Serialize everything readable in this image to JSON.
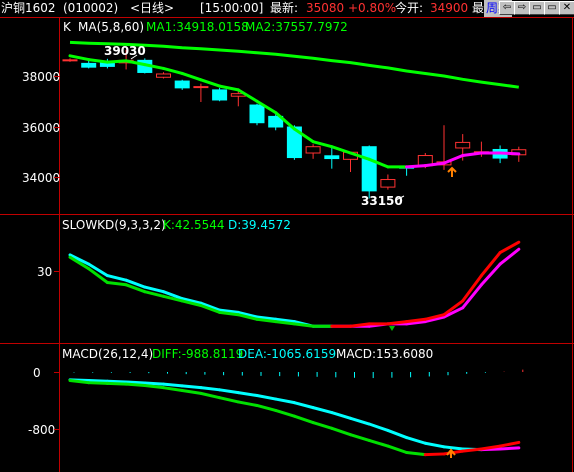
{
  "header": {
    "symbol": "沪铜1602",
    "code": "(010002)",
    "period_tag": "<日线>",
    "time": "[15:00:00]",
    "latest_label": "最新:",
    "latest_value": "35080",
    "change": "+0.80%",
    "open_label": "今开:",
    "open_value": "34900",
    "high_label": "最高:",
    "period_link": "周期",
    "nav_buttons": [
      "⇦",
      "⇨",
      "▭",
      "▭",
      "✕"
    ]
  },
  "colors": {
    "up": "#ff3232",
    "down": "#00ffff",
    "ma1": "#00ff00",
    "ma2": "#00ff00",
    "kd_k": "#00e000",
    "kd_d": "#00ffff",
    "macd_diff": "#00e000",
    "macd_dea": "#00ffff",
    "accent_red": "#ff0000",
    "accent_magenta": "#ff00ff"
  },
  "price_panel": {
    "label_k": "K",
    "ma_label": "MA(5,8,60)",
    "ma1_label": "MA1:34918.0158",
    "ma2_label": "MA2:37557.7972",
    "y_ticks": [
      "38000",
      "36000",
      "34000"
    ],
    "annotation_high": "39030",
    "annotation_low": "33150"
  },
  "kd_panel": {
    "label": "SLOWKD(9,3,3,2)",
    "k_label": "K:42.5544",
    "d_label": "D:39.4572",
    "y_ticks": [
      "30"
    ]
  },
  "macd_panel": {
    "label": "MACD(26,12,4)",
    "diff_label": "DIFF:-988.8119",
    "dea_label": "DEA:-1065.6159",
    "macd_label": "MACD:153.6080",
    "y_ticks": [
      "0",
      "-800"
    ]
  },
  "chart_data": {
    "type": "line",
    "candles": [
      {
        "o": 38640,
        "c": 38640,
        "h": 38700,
        "l": 38560
      },
      {
        "o": 38500,
        "c": 38350,
        "h": 38600,
        "l": 38300
      },
      {
        "o": 38520,
        "c": 38380,
        "h": 38680,
        "l": 38300
      },
      {
        "o": 38520,
        "c": 38620,
        "h": 39030,
        "l": 38260
      },
      {
        "o": 38620,
        "c": 38140,
        "h": 38700,
        "l": 38100
      },
      {
        "o": 37950,
        "c": 38080,
        "h": 38150,
        "l": 37900
      },
      {
        "o": 37800,
        "c": 37530,
        "h": 37850,
        "l": 37450
      },
      {
        "o": 37580,
        "c": 37580,
        "h": 37700,
        "l": 36970
      },
      {
        "o": 37450,
        "c": 37050,
        "h": 37530,
        "l": 37000
      },
      {
        "o": 37200,
        "c": 37300,
        "h": 37500,
        "l": 36800
      },
      {
        "o": 36850,
        "c": 36150,
        "h": 36900,
        "l": 36050
      },
      {
        "o": 36400,
        "c": 35980,
        "h": 36480,
        "l": 35850
      },
      {
        "o": 35980,
        "c": 34770,
        "h": 36050,
        "l": 34680
      },
      {
        "o": 34950,
        "c": 35200,
        "h": 35300,
        "l": 34720
      },
      {
        "o": 34840,
        "c": 34730,
        "h": 35230,
        "l": 34330
      },
      {
        "o": 34700,
        "c": 34980,
        "h": 35000,
        "l": 34200
      },
      {
        "o": 35200,
        "c": 33450,
        "h": 35250,
        "l": 33150
      },
      {
        "o": 33600,
        "c": 33900,
        "h": 34100,
        "l": 33500
      },
      {
        "o": 34400,
        "c": 34350,
        "h": 34450,
        "l": 34050
      },
      {
        "o": 34450,
        "c": 34850,
        "h": 34950,
        "l": 34350
      },
      {
        "o": 34480,
        "c": 34600,
        "h": 36050,
        "l": 34280
      },
      {
        "o": 35150,
        "c": 35370,
        "h": 35700,
        "l": 34650
      },
      {
        "o": 35000,
        "c": 35000,
        "h": 35400,
        "l": 34800
      },
      {
        "o": 35090,
        "c": 34750,
        "h": 35250,
        "l": 34550
      },
      {
        "o": 34880,
        "c": 35080,
        "h": 35200,
        "l": 34600
      }
    ],
    "ma1": [
      38800,
      38650,
      38550,
      38600,
      38450,
      38300,
      38100,
      37850,
      37600,
      37450,
      37000,
      36550,
      35900,
      35400,
      35200,
      34950,
      34700,
      34400,
      34400,
      34450,
      34550,
      34850,
      34950,
      34950,
      34918
    ],
    "ma2": [
      39330,
      39300,
      39280,
      39250,
      39220,
      39180,
      39120,
      39080,
      39030,
      38980,
      38920,
      38860,
      38780,
      38700,
      38610,
      38530,
      38420,
      38320,
      38200,
      38100,
      38000,
      37870,
      37760,
      37660,
      37558
    ],
    "slowkd_k": [
      36,
      31,
      25,
      24,
      21,
      19,
      17,
      15,
      12,
      11,
      9,
      8,
      7,
      6,
      6,
      6,
      7,
      7,
      8,
      9,
      11,
      17,
      28,
      38,
      42.55
    ],
    "slowkd_d": [
      37,
      33,
      28,
      26,
      23,
      21,
      18,
      16,
      13,
      12,
      10,
      9,
      8,
      6,
      6,
      6,
      6,
      7,
      7,
      8,
      10,
      14,
      24,
      33,
      39.46
    ],
    "macd_diff": [
      -120,
      -150,
      -160,
      -170,
      -190,
      -220,
      -260,
      -300,
      -360,
      -420,
      -470,
      -540,
      -620,
      -710,
      -790,
      -880,
      -960,
      -1040,
      -1130,
      -1160,
      -1150,
      -1110,
      -1080,
      -1040,
      -988.81
    ],
    "macd_dea": [
      -110,
      -120,
      -130,
      -140,
      -155,
      -170,
      -195,
      -220,
      -250,
      -290,
      -330,
      -380,
      -430,
      -500,
      -570,
      -650,
      -730,
      -820,
      -920,
      -1000,
      -1050,
      -1080,
      -1090,
      -1080,
      -1065.62
    ],
    "macd_bars": [
      -5,
      -15,
      -20,
      -30,
      -45,
      -70,
      -100,
      -130,
      -160,
      -180,
      -195,
      -210,
      -230,
      -250,
      -280,
      -300,
      -320,
      -300,
      -280,
      -230,
      -160,
      -80,
      -20,
      40,
      153.6
    ],
    "price_ylim": [
      33150,
      39430
    ],
    "kd_ylim": [
      0,
      50
    ],
    "macd_ylim": [
      -1200,
      20
    ]
  }
}
